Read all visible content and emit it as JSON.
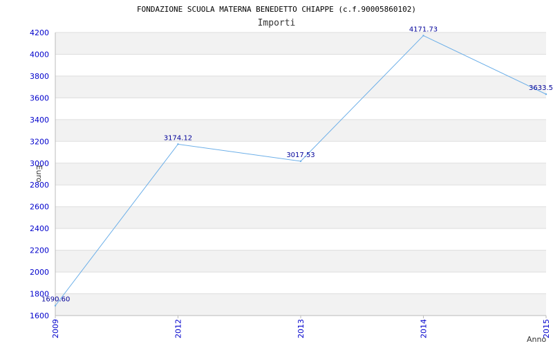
{
  "chart_data": {
    "type": "line",
    "title": "FONDAZIONE SCUOLA MATERNA BENEDETTO CHIAPPE (c.f.90005860102)",
    "subtitle": "Importi",
    "xlabel": "Anno",
    "ylabel": "Euro",
    "categories": [
      "2009",
      "2012",
      "2013",
      "2014",
      "2015"
    ],
    "series": [
      {
        "values": [
          1690.6,
          3174.12,
          3017.53,
          4171.73,
          3633.5
        ],
        "value_labels": [
          "1690.60",
          "3174.12",
          "3017.53",
          "4171.73",
          "3633.5"
        ]
      }
    ],
    "ylim": [
      1600,
      4200
    ],
    "yticks": [
      1600,
      1800,
      2000,
      2200,
      2400,
      2600,
      2800,
      3000,
      3200,
      3400,
      3600,
      3800,
      4000,
      4200
    ],
    "grid": true,
    "legend": "none",
    "colors": {
      "line": "#6aaee8",
      "band": "#f2f2f2",
      "grid": "#dddddd",
      "tick": "#0000cc",
      "value_label": "#000099"
    }
  }
}
